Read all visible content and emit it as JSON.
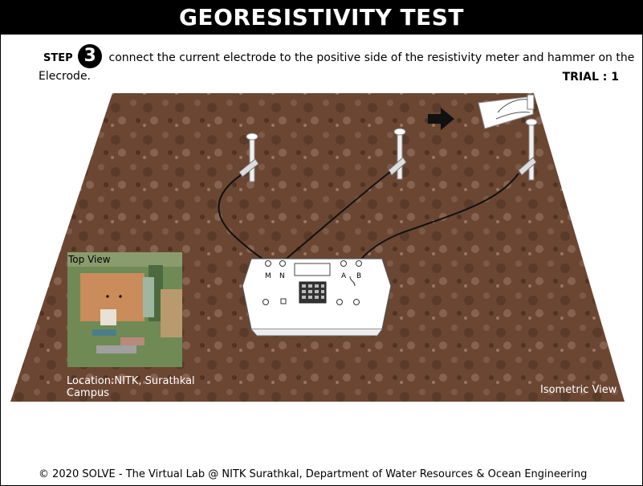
{
  "header": {
    "title": "GEORESISTIVITY TEST"
  },
  "instruction": {
    "step_label": "STEP",
    "step_number": "3",
    "text": "connect the current electrode to the positive side of the resistivity meter and hammer on the Elecrode."
  },
  "trial": {
    "label": "TRIAL : 1"
  },
  "map": {
    "top_view_label": "Top View",
    "location_label": "Location:NITK, Surathkal Campus"
  },
  "view": {
    "label": "Isometric View"
  },
  "meter": {
    "terminal_m": "M",
    "terminal_n": "N",
    "terminal_a": "A",
    "terminal_b": "B"
  },
  "footer": {
    "copyright": "© 2020 SOLVE - The Virtual Lab @ NITK Surathkal, Department of Water Resources & Ocean Engineering"
  },
  "colors": {
    "soil": "#6e4a35",
    "header_bg": "#000000"
  }
}
